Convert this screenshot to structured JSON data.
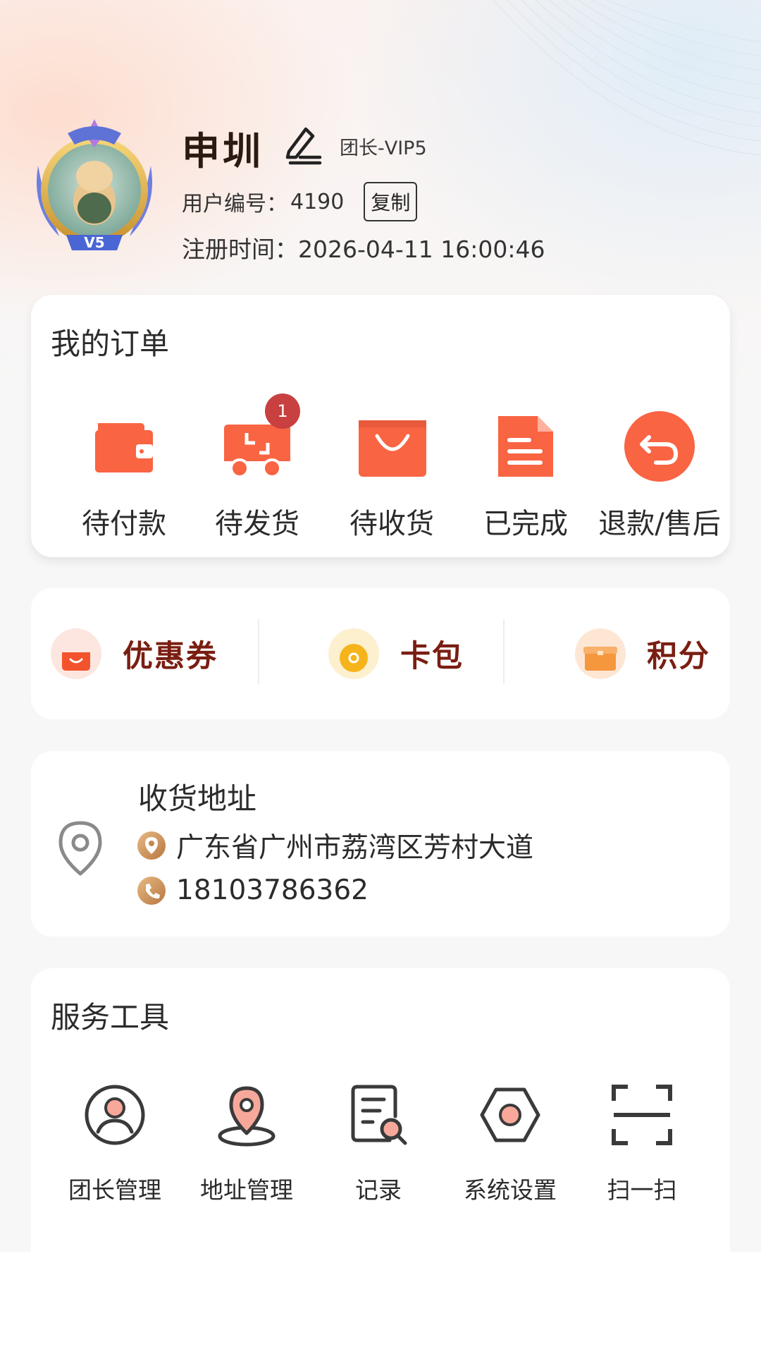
{
  "profile": {
    "name": "申圳",
    "level": "团长-VIP5",
    "uid_label": "用户编号：",
    "uid": "4190",
    "copy_label": "复制",
    "reg_label": "注册时间：",
    "reg_time": "2026-04-11 16:00:46",
    "avatar_badge": "V5"
  },
  "orders": {
    "title": "我的订单",
    "items": [
      {
        "label": "待付款",
        "icon": "wallet-icon"
      },
      {
        "label": "待发货",
        "icon": "truck-icon",
        "badge": "1"
      },
      {
        "label": "待收货",
        "icon": "shopping-bag-icon"
      },
      {
        "label": "已完成",
        "icon": "document-icon"
      },
      {
        "label": "退款/售后",
        "icon": "return-icon"
      }
    ]
  },
  "assets": {
    "items": [
      {
        "label": "优惠券",
        "icon": "coupon-icon"
      },
      {
        "label": "卡包",
        "icon": "coin-icon"
      },
      {
        "label": "积分",
        "icon": "points-box-icon"
      }
    ]
  },
  "address": {
    "title": "收货地址",
    "location": "广东省广州市荔湾区芳村大道",
    "phone": "18103786362"
  },
  "tools": {
    "title": "服务工具",
    "items": [
      {
        "label": "团长管理",
        "icon": "user-circle-icon"
      },
      {
        "label": "地址管理",
        "icon": "map-pin-icon"
      },
      {
        "label": "记录",
        "icon": "record-search-icon"
      },
      {
        "label": "系统设置",
        "icon": "hex-settings-icon"
      },
      {
        "label": "扫一扫",
        "icon": "scan-icon"
      }
    ]
  },
  "colors": {
    "accent": "#f96443",
    "badge": "#c8403f",
    "asset_text": "#7a1e12"
  }
}
